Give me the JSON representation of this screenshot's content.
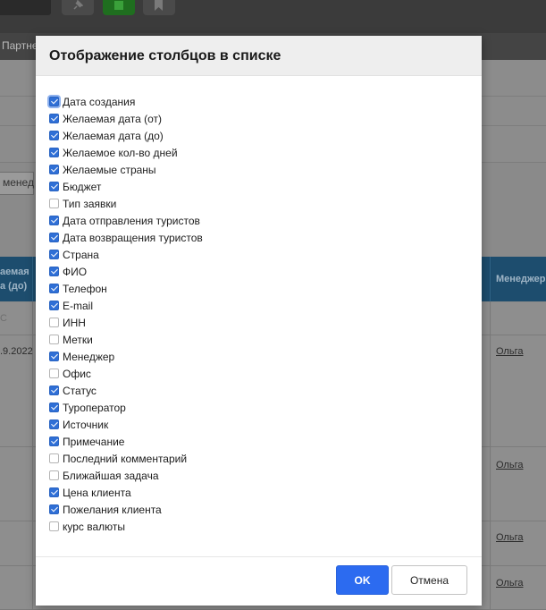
{
  "background": {
    "nav_partial": "Партне",
    "manager_select_partial": "менед",
    "header_col_partial": "аемая\nа (до)",
    "header_manager": "Менеджер",
    "row_c_partial": "С",
    "row_date_partial": ".9.2022",
    "manager_link": "Ольга",
    "icons": [
      "pin-icon",
      "bookmark-icon"
    ]
  },
  "modal": {
    "title": "Отображение столбцов в списке",
    "options": [
      {
        "label": "Дата создания",
        "checked": true,
        "focused": true
      },
      {
        "label": "Желаемая дата (от)",
        "checked": true
      },
      {
        "label": "Желаемая дата (до)",
        "checked": true
      },
      {
        "label": "Желаемое кол-во дней",
        "checked": true
      },
      {
        "label": "Желаемые страны",
        "checked": true
      },
      {
        "label": "Бюджет",
        "checked": true
      },
      {
        "label": "Тип заявки",
        "checked": false
      },
      {
        "label": "Дата отправления туристов",
        "checked": true
      },
      {
        "label": "Дата возвращения туристов",
        "checked": true
      },
      {
        "label": "Страна",
        "checked": true
      },
      {
        "label": "ФИО",
        "checked": true
      },
      {
        "label": "Телефон",
        "checked": true
      },
      {
        "label": "E-mail",
        "checked": true
      },
      {
        "label": "ИНН",
        "checked": false
      },
      {
        "label": "Метки",
        "checked": false
      },
      {
        "label": "Менеджер",
        "checked": true
      },
      {
        "label": "Офис",
        "checked": false
      },
      {
        "label": "Статус",
        "checked": true
      },
      {
        "label": "Туроператор",
        "checked": true
      },
      {
        "label": "Источник",
        "checked": true
      },
      {
        "label": "Примечание",
        "checked": true
      },
      {
        "label": "Последний комментарий",
        "checked": false
      },
      {
        "label": "Ближайшая задача",
        "checked": false
      },
      {
        "label": "Цена клиента",
        "checked": true
      },
      {
        "label": "Пожелания клиента",
        "checked": true
      },
      {
        "label": "курс валюты",
        "checked": false
      }
    ],
    "ok_label": "OK",
    "cancel_label": "Отмена"
  },
  "colors": {
    "accent": "#2c6bf0",
    "checkbox_checked": "#2f6fd6",
    "overlay_header": "#1d4d6e"
  }
}
